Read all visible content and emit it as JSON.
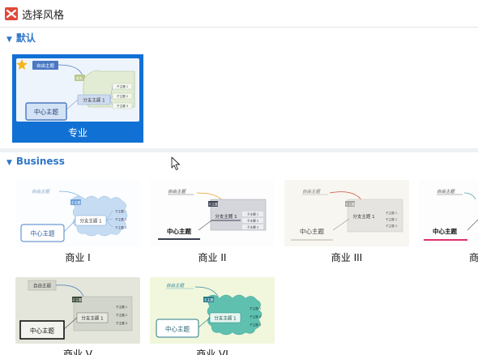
{
  "window": {
    "title": "选择风格"
  },
  "sections": {
    "default": {
      "label": "默认"
    },
    "business": {
      "label": "Business"
    }
  },
  "thumb_text": {
    "free": "自由主题",
    "central": "中心主题",
    "branch": "分支主题 1",
    "sub": "子主题",
    "sub1": "子主题 1",
    "sub2": "子主题 2",
    "sub3": "子主题 3",
    "link": "联系"
  },
  "styles": [
    {
      "label": "专业",
      "selected": true
    },
    {
      "label": "商业 I"
    },
    {
      "label": "商业 II"
    },
    {
      "label": "商业 III"
    },
    {
      "label": "商业"
    },
    {
      "label": "商业 V"
    },
    {
      "label": "商业 VI"
    }
  ],
  "colors": {
    "accent": "#1170d4",
    "section_text": "#2f76c8",
    "brand_red": "#e0493a",
    "star": "#f4b61a"
  }
}
